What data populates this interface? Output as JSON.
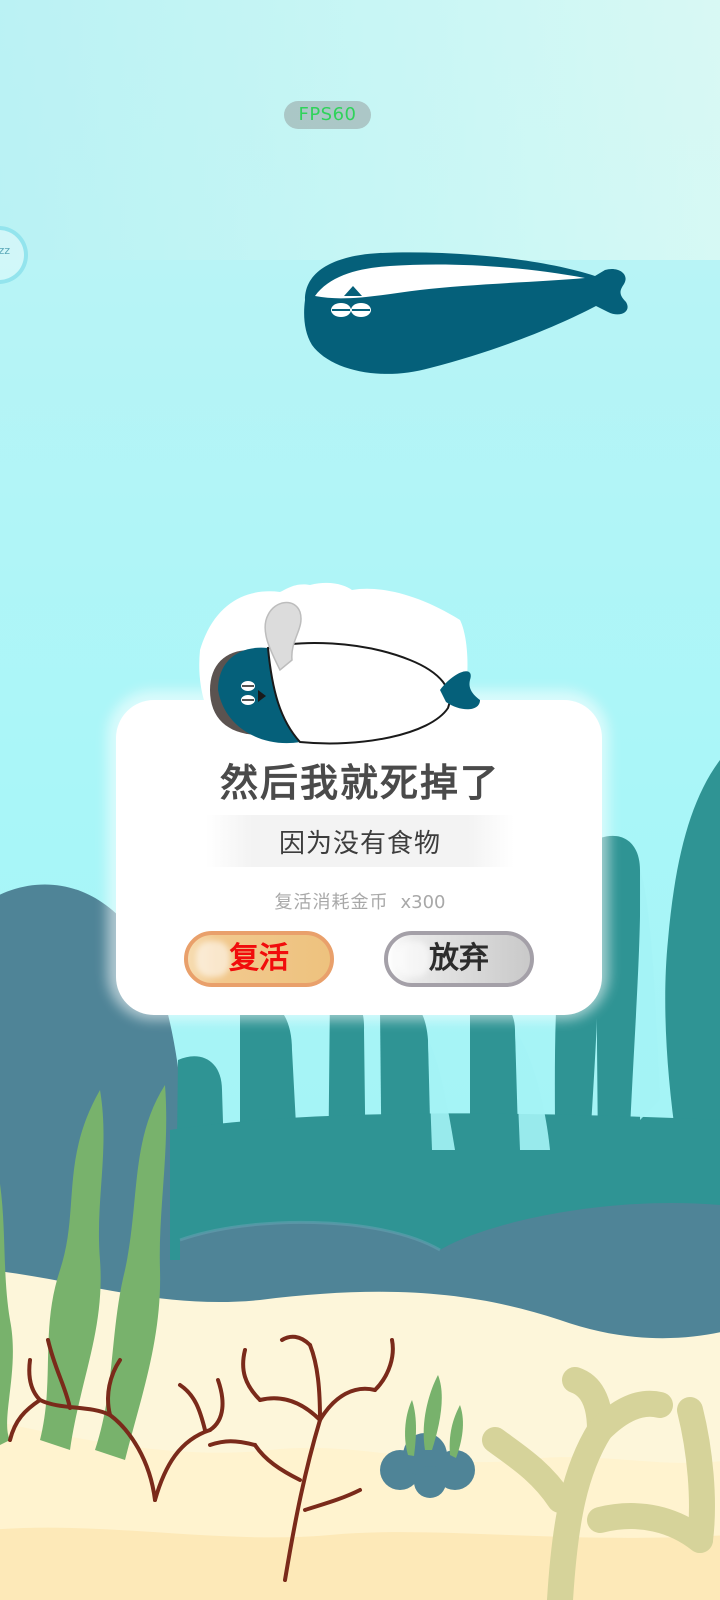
{
  "hud": {
    "fps_label": "FPS60",
    "side_bubble_icon": "zz"
  },
  "dialog": {
    "title": "然后我就死掉了",
    "subtitle": "因为没有食物",
    "cost_label": "复活消耗金币",
    "cost_value": "x300",
    "revive_label": "复活",
    "giveup_label": "放弃"
  },
  "colors": {
    "sky": "#b2f4f6",
    "fish": "#05607a",
    "rock": "#4f8497",
    "kelp_dark": "#2f9494",
    "seaweed": "#78b26c",
    "sand": "#fff7df",
    "branch_coral": "#7a2a1a",
    "revive_text": "#f10c0c",
    "fps_text": "#2fd35a"
  }
}
